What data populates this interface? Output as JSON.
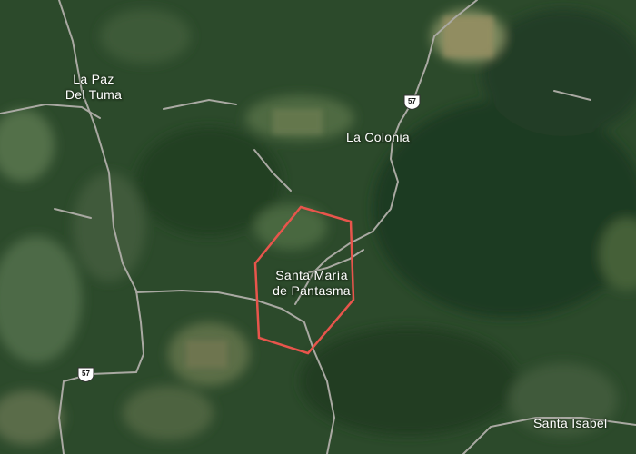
{
  "map": {
    "type": "satellite",
    "places": [
      {
        "id": "la-paz-del-tuma",
        "line1": "La Paz",
        "line2": "Del Tuma"
      },
      {
        "id": "la-colonia",
        "line1": "La Colonia"
      },
      {
        "id": "santa-maria",
        "line1": "Santa María",
        "line2": "de Pantasma"
      },
      {
        "id": "santa-isabel",
        "line1": "Santa Isabel"
      }
    ],
    "route_shields": [
      {
        "id": "north",
        "number": "57"
      },
      {
        "id": "south",
        "number": "57"
      }
    ],
    "boundary_color": "#e8554c",
    "road_color": "#a9a9a2"
  }
}
